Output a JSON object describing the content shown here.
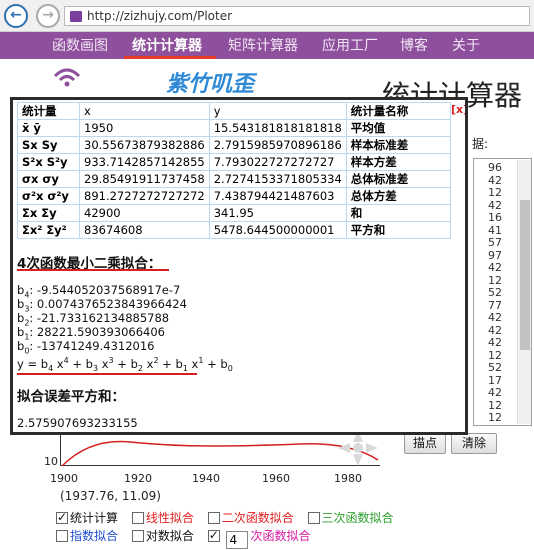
{
  "browser": {
    "url": "http://zizhujy.com/Ploter"
  },
  "nav": {
    "items": [
      "函数画图",
      "统计计算器",
      "矩阵计算器",
      "应用工厂",
      "博客",
      "关于"
    ],
    "active": "统计计算器"
  },
  "header": {
    "brand": "紫竹叽歪",
    "page_title": "统计计算器",
    "data_label": "据:"
  },
  "data_column": [
    "96",
    "42",
    "12",
    "42",
    "16",
    "41",
    "57",
    "97",
    "42",
    "12",
    "52",
    "77",
    "42",
    "42",
    "42",
    "12",
    "52",
    "17",
    "42",
    "12",
    "12"
  ],
  "stats_table": {
    "headers": [
      "统计量",
      "x",
      "y",
      "统计量名称"
    ],
    "rows": [
      {
        "sym": "x̄ ȳ",
        "x": "1950",
        "y": "15.543181818181818",
        "name": "平均值"
      },
      {
        "sym": "Sx Sy",
        "x": "30.55673879382886",
        "y": "2.7915985970896186",
        "name": "样本标准差"
      },
      {
        "sym": "S²x S²y",
        "x": "933.7142857142855",
        "y": "7.793022727272727",
        "name": "样本方差"
      },
      {
        "sym": "σx σy",
        "x": "29.85491911737458",
        "y": "2.727415337180533​4",
        "name": "总体标准差"
      },
      {
        "sym": "σ²x σ²y",
        "x": "891.2727272727272",
        "y": "7.438794421487603",
        "name": "总体方差"
      },
      {
        "sym": "Σx Σy",
        "x": "42900",
        "y": "341.95",
        "name": "和"
      },
      {
        "sym": "Σx² Σy²",
        "x": "83674608",
        "y": "5478.644500000001",
        "name": "平方和"
      }
    ],
    "close_label": "[x]"
  },
  "fit": {
    "title": "4次函数最小二乘拟合：",
    "coefficients": [
      {
        "label": "b",
        "sub": "4",
        "value": ": -9.544052037568917e-7"
      },
      {
        "label": "b",
        "sub": "3",
        "value": ": 0.007437652384396642​4"
      },
      {
        "label": "b",
        "sub": "2",
        "value": ": -21.733162134885788"
      },
      {
        "label": "b",
        "sub": "1",
        "value": ": 28221.590393066406"
      },
      {
        "label": "b",
        "sub": "0",
        "value": ": -13741249.4312016"
      }
    ],
    "formula": "y = b4 x4 + b3 x3 + b2 x2 + b1 x1 + b0",
    "residual_title": "拟合误差平方和：",
    "residual_value": "2.575907693233155"
  },
  "plot": {
    "x_ticks": [
      "1900",
      "1920",
      "1940",
      "1960",
      "1980"
    ],
    "y_tick": "10",
    "coordinate": "(1937.76, 11.09)"
  },
  "buttons": {
    "plot": "描点",
    "clear": "清除"
  },
  "options": {
    "row1": [
      {
        "label": "统计计算",
        "checked": true,
        "color": "#111111"
      },
      {
        "label": "线性拟合",
        "checked": false,
        "color": "#e02020"
      },
      {
        "label": "二次函数拟合",
        "checked": false,
        "color": "#e02020"
      },
      {
        "label": "三次函数拟合",
        "checked": false,
        "color": "#2ca02c"
      }
    ],
    "row2": [
      {
        "label": "指数拟合",
        "checked": false,
        "color": "#1f4fd0"
      },
      {
        "label": "对数拟合",
        "checked": false,
        "color": "#111111"
      },
      {
        "label": "",
        "checked": true,
        "color": "#111111"
      }
    ],
    "degree_value": "4",
    "degree_label": "次函数拟合",
    "degree_color": "#d81ba0"
  }
}
